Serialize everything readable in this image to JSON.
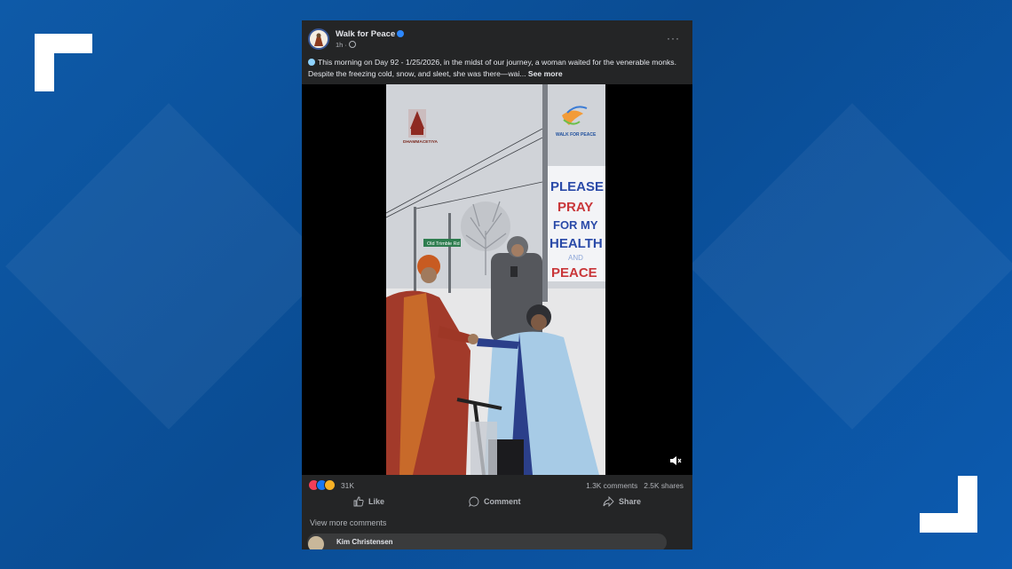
{
  "post": {
    "author": "Walk for Peace",
    "time": "1h",
    "text": "This morning on Day 92 - 1/25/2026, in the midst of our journey, a woman waited for the venerable monks. Despite the freezing cold, snow, and sleet, she was there—wai...",
    "see_more": "See more",
    "more_icon": "···"
  },
  "video": {
    "logo_left_text": "DHAMMACETIYA",
    "logo_right_text": "WALK FOR PEACE",
    "street_sign": "Old Trimble Rd",
    "sign_text": [
      "PLEASE",
      "PRAY",
      "FOR MY",
      "HEALTH",
      "AND",
      "PEACE"
    ]
  },
  "stats": {
    "reactions_count": "31K",
    "comments": "1.3K comments",
    "shares": "2.5K shares"
  },
  "actions": {
    "like": "Like",
    "comment": "Comment",
    "share": "Share"
  },
  "comments": {
    "view_more": "View more comments",
    "first_commenter": "Kim Christensen"
  },
  "colors": {
    "background": "#0b58ab",
    "post_bg": "#242526",
    "text": "#e4e6eb",
    "muted": "#b0b3b8",
    "verified": "#2d88ff"
  }
}
